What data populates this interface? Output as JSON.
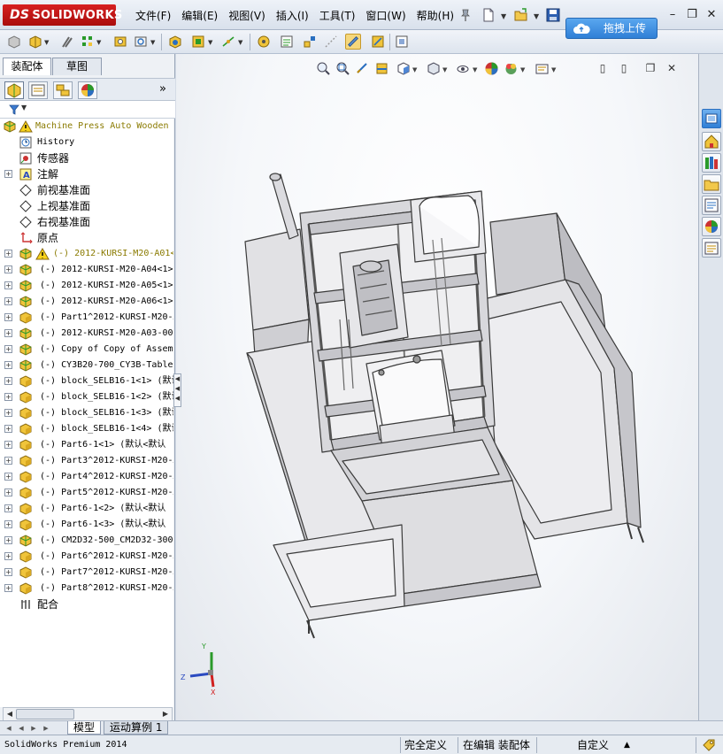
{
  "app": {
    "logo_text": "SOLIDWORKS",
    "logo_prefix": "DS",
    "menus": [
      "文件(F)",
      "编辑(E)",
      "视图(V)",
      "插入(I)",
      "工具(T)",
      "窗口(W)",
      "帮助(H)"
    ],
    "upload_label": "拖拽上传",
    "window_controls": [
      "–",
      "❐",
      "✕"
    ]
  },
  "panel": {
    "tabs": [
      "装配体",
      "草图"
    ]
  },
  "tree": {
    "root_label": "Machine Press Auto Wooden",
    "items": [
      {
        "label": "History",
        "icon": "history-icon",
        "cn": false,
        "expand": false
      },
      {
        "label": "传感器",
        "icon": "sensor-icon",
        "cn": true,
        "expand": false
      },
      {
        "label": "注解",
        "icon": "annotation-icon",
        "cn": true,
        "expand": true
      },
      {
        "label": "前视基准面",
        "icon": "plane-icon",
        "cn": true,
        "expand": false
      },
      {
        "label": "上视基准面",
        "icon": "plane-icon",
        "cn": true,
        "expand": false
      },
      {
        "label": "右视基准面",
        "icon": "plane-icon",
        "cn": true,
        "expand": false
      },
      {
        "label": "原点",
        "icon": "origin-icon",
        "cn": true,
        "expand": false
      },
      {
        "label": "(-) 2012-KURSI-M20-A01<",
        "icon": "assembly-icon",
        "warn": true,
        "cn": false,
        "expand": true
      },
      {
        "label": "(-) 2012-KURSI-M20-A04<1>",
        "icon": "assembly-icon",
        "cn": false,
        "expand": true
      },
      {
        "label": "(-) 2012-KURSI-M20-A05<1>",
        "icon": "assembly-icon",
        "cn": false,
        "expand": true
      },
      {
        "label": "(-) 2012-KURSI-M20-A06<1>",
        "icon": "assembly-icon",
        "cn": false,
        "expand": true
      },
      {
        "label": "(-) Part1^2012-KURSI-M20-A",
        "icon": "part-icon",
        "cn": false,
        "expand": true
      },
      {
        "label": "(-) 2012-KURSI-M20-A03-00",
        "icon": "assembly-icon",
        "cn": false,
        "expand": true
      },
      {
        "label": "(-) Copy of Copy of Assem",
        "icon": "assembly-icon",
        "cn": false,
        "expand": true
      },
      {
        "label": "(-) CY3B20-700_CY3B-Table",
        "icon": "assembly-icon",
        "cn": false,
        "expand": true
      },
      {
        "label": "(-) block_SELB16-1<1> (默认",
        "icon": "part-icon",
        "cn": false,
        "expand": true
      },
      {
        "label": "(-) block_SELB16-1<2> (默认",
        "icon": "part-icon",
        "cn": false,
        "expand": true
      },
      {
        "label": "(-) block_SELB16-1<3> (默认",
        "icon": "part-icon",
        "cn": false,
        "expand": true
      },
      {
        "label": "(-) block_SELB16-1<4> (默认",
        "icon": "part-icon",
        "cn": false,
        "expand": true
      },
      {
        "label": "(-) Part6-1<1> (默认<默认",
        "icon": "part-icon",
        "cn": false,
        "expand": true
      },
      {
        "label": "(-) Part3^2012-KURSI-M20-A",
        "icon": "part-icon",
        "cn": false,
        "expand": true
      },
      {
        "label": "(-) Part4^2012-KURSI-M20-A",
        "icon": "part-icon",
        "cn": false,
        "expand": true
      },
      {
        "label": "(-) Part5^2012-KURSI-M20-A",
        "icon": "part-icon",
        "cn": false,
        "expand": true
      },
      {
        "label": "(-) Part6-1<2> (默认<默认",
        "icon": "part-icon",
        "cn": false,
        "expand": true
      },
      {
        "label": "(-) Part6-1<3> (默认<默认",
        "icon": "part-icon",
        "cn": false,
        "expand": true
      },
      {
        "label": "(-) CM2D32-500_CM2D32-300-",
        "icon": "assembly-icon",
        "cn": false,
        "expand": true
      },
      {
        "label": "(-) Part6^2012-KURSI-M20-A",
        "icon": "part-icon",
        "cn": false,
        "expand": true
      },
      {
        "label": "(-) Part7^2012-KURSI-M20-A",
        "icon": "part-icon",
        "cn": false,
        "expand": true
      },
      {
        "label": "(-) Part8^2012-KURSI-M20-A",
        "icon": "part-icon",
        "cn": false,
        "expand": true
      },
      {
        "label": "配合",
        "icon": "mates-icon",
        "cn": true,
        "expand": false
      }
    ]
  },
  "bottom_tabs": [
    "模型",
    "运动算例 1"
  ],
  "status": {
    "product": "SolidWorks Premium 2014",
    "definition": "完全定义",
    "mode": "在编辑 装配体",
    "units": "自定义",
    "units_arrow": "▲"
  },
  "triad": {
    "x": "X",
    "y": "Y",
    "z": "Z"
  },
  "colors": {
    "brand_red": "#c0171a",
    "frame_fill": "#d9d9dc",
    "frame_stroke": "#3a3a3a",
    "upload_blue": "#3a8ae0"
  }
}
